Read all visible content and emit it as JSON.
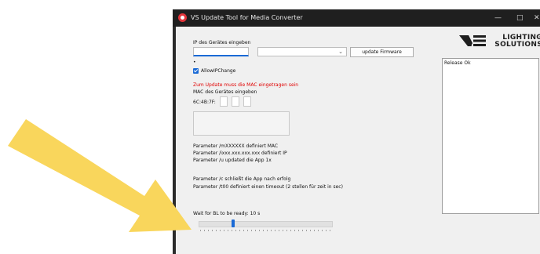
{
  "window": {
    "title": "VS Update Tool for Media Converter",
    "minimize_glyph": "—",
    "maximize_glyph": "□",
    "close_glyph": "✕"
  },
  "logo": {
    "line1": "LIGHTING",
    "line2": "SOLUTIONS"
  },
  "form": {
    "ip_label": "IP des Gerätes eingeben",
    "ip_value": "",
    "select_value": "",
    "update_button": "update Firmware",
    "dot": "•",
    "checkbox_label": "AllowIPChange",
    "checkbox_checked": true,
    "mac_warning": "Zum Update muss die MAC eingetragen sein",
    "mac_label": "MAC des Gerätes eingeben",
    "mac_prefix": "6C:4B:7F:"
  },
  "help": {
    "lines": [
      "Parameter /mXXXXXX definiert MAC",
      "Parameter /ixxx.xxx.xxx.xxx definiert IP",
      "Parameter /u updated die App 1x",
      "Parameter /c schließt die App nach erfolg",
      "Parameter /t00 definiert einen timeout (2 stellen für zeit in sec)"
    ]
  },
  "slider": {
    "label": "Wait for BL to be ready: 10 s",
    "value_fraction": 0.26
  },
  "log": {
    "text": "Release Ok"
  },
  "colors": {
    "accent": "#1a6ad6",
    "warning": "#e00000",
    "arrow": "#f9d65c",
    "titlebar": "#1f1f1f"
  }
}
